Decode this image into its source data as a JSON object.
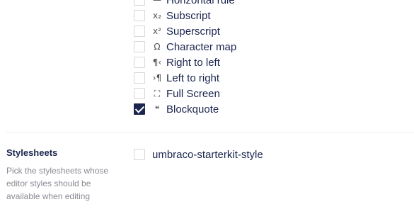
{
  "toolbar_options": [
    {
      "label": "Horizontal rule",
      "icon": "horizontal-rule-icon",
      "glyph": "—",
      "checked": false
    },
    {
      "label": "Subscript",
      "icon": "subscript-icon",
      "glyph": "x₂",
      "checked": false
    },
    {
      "label": "Superscript",
      "icon": "superscript-icon",
      "glyph": "x²",
      "checked": false
    },
    {
      "label": "Character map",
      "icon": "omega-icon",
      "glyph": "Ω",
      "checked": false
    },
    {
      "label": "Right to left",
      "icon": "rtl-icon",
      "glyph": "¶‹",
      "checked": false
    },
    {
      "label": "Left to right",
      "icon": "ltr-icon",
      "glyph": "›¶",
      "checked": false
    },
    {
      "label": "Full Screen",
      "icon": "fullscreen-icon",
      "glyph": "⛶",
      "checked": false
    },
    {
      "label": "Blockquote",
      "icon": "quote-icon",
      "glyph": "❝",
      "checked": true
    }
  ],
  "stylesheets": {
    "label": "Stylesheets",
    "description": "Pick the stylesheets whose editor styles should be available when editing",
    "items": [
      {
        "label": "umbraco-starterkit-style",
        "checked": false
      }
    ]
  }
}
